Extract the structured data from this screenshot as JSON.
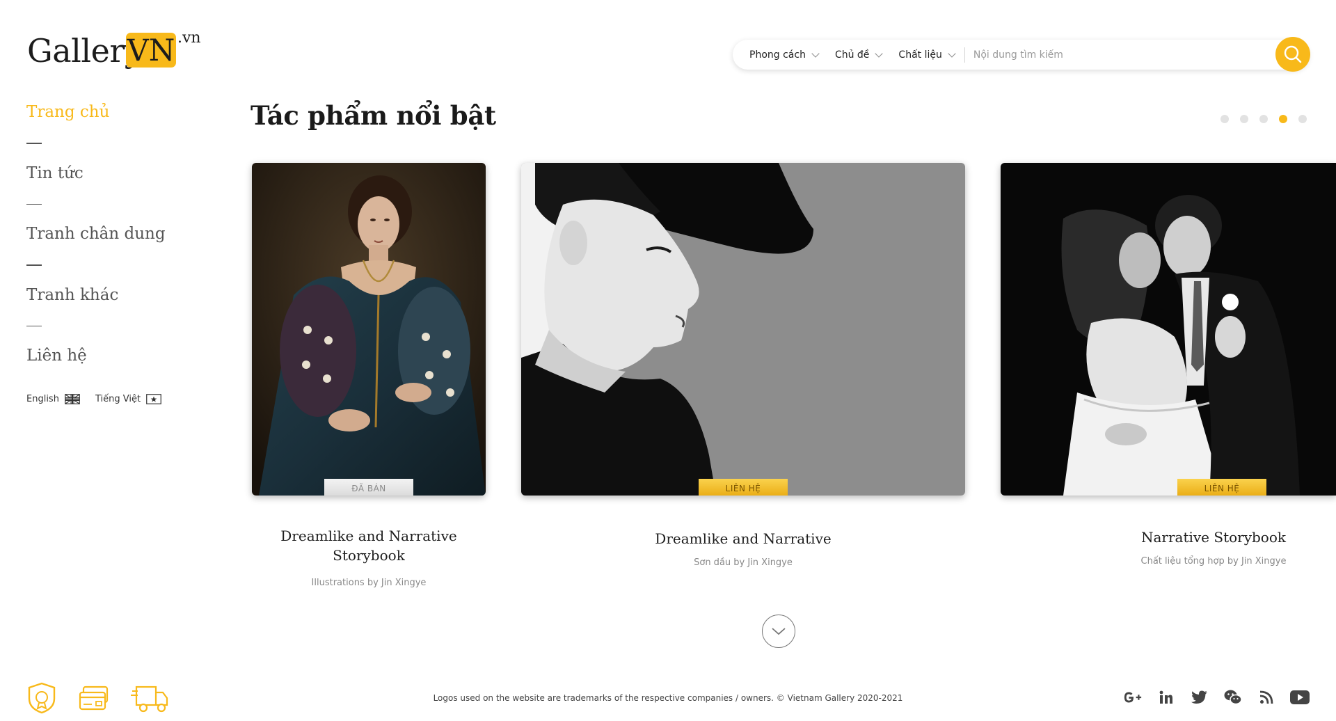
{
  "brand": {
    "name": "Gallery",
    "highlight": "VN",
    "tld": ".vn",
    "accent_color": "#f8b91a"
  },
  "search": {
    "filters": [
      {
        "label": "Phong cách"
      },
      {
        "label": "Chủ đề"
      },
      {
        "label": "Chất liệu"
      }
    ],
    "placeholder": "Nội dung tìm kiếm",
    "button_icon": "search-icon"
  },
  "sidebar": {
    "items": [
      {
        "label": "Trang chủ",
        "active": true
      },
      {
        "label": "Tin tức",
        "active": false
      },
      {
        "label": "Tranh chân dung",
        "active": false
      },
      {
        "label": "Tranh khác",
        "active": false
      },
      {
        "label": "Liên hệ",
        "active": false
      }
    ],
    "languages": [
      {
        "label": "English",
        "icon": "uk-flag-icon"
      },
      {
        "label": "Tiếng Việt",
        "icon": "vietnam-flag-icon"
      }
    ]
  },
  "featured": {
    "title": "Tác phẩm nổi bật",
    "active_slide": 4,
    "slide_count": 5,
    "cards": [
      {
        "title": "Dreamlike and Narrative Storybook",
        "subtitle": "Illustrations by Jin Xingye",
        "badge": "ĐÃ BÁN",
        "status": "sold",
        "image": "renaissance-portrait"
      },
      {
        "title": "Dreamlike and Narrative",
        "subtitle": "Sơn dầu by Jin Xingye",
        "badge": "LIÊN HỆ",
        "status": "contact",
        "image": "woman-hat-profile"
      },
      {
        "title": "Narrative Storybook",
        "subtitle": "Chất liệu tổng hợp by Jin Xingye",
        "badge": "LIÊN HỆ",
        "status": "contact",
        "image": "couple-dancing"
      }
    ],
    "scroll_icon": "chevron-down-icon"
  },
  "footer": {
    "badges": [
      "quality-certificate-icon",
      "payment-card-icon",
      "delivery-truck-icon"
    ],
    "copyright": "Logos used on the website are trademarks of the respective companies / owners.  © Vietnam Gallery 2020-2021",
    "social": [
      "google-plus-icon",
      "linkedin-icon",
      "twitter-icon",
      "wechat-icon",
      "rss-icon",
      "youtube-icon"
    ]
  }
}
